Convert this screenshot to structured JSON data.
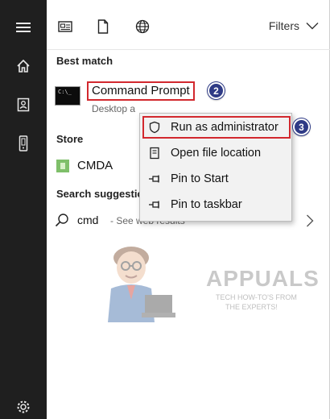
{
  "rail": {
    "icons": [
      "hamburger-menu-icon",
      "home-icon",
      "documents-icon",
      "device-icon",
      "settings-icon"
    ]
  },
  "topbar": {
    "tab_icons": [
      "apps-view-icon",
      "document-icon",
      "web-globe-icon"
    ],
    "filters_label": "Filters"
  },
  "best_match": {
    "heading": "Best match",
    "title": "Command Prompt",
    "subtitle": "Desktop a",
    "step_badge": "2"
  },
  "store": {
    "heading": "Store",
    "item_label": "CMDA"
  },
  "search_suggestions": {
    "heading": "Search suggestion",
    "term": "cmd",
    "hint": "- See web results"
  },
  "context_menu": {
    "items": [
      {
        "label": "Run as administrator",
        "icon": "shield-icon"
      },
      {
        "label": "Open file location",
        "icon": "folder-location-icon"
      },
      {
        "label": "Pin to Start",
        "icon": "pin-icon"
      },
      {
        "label": "Pin to taskbar",
        "icon": "pin-icon"
      }
    ],
    "step_badge": "3"
  },
  "watermark": {
    "brand": "APPUALS",
    "tagline_line1": "TECH HOW-TO'S FROM",
    "tagline_line2": "THE EXPERTS!"
  },
  "colors": {
    "rail_bg": "#1f1f1f",
    "highlight_red": "#d2282e",
    "badge_blue": "#2f3b86",
    "menu_bg": "#f2f2f2"
  }
}
